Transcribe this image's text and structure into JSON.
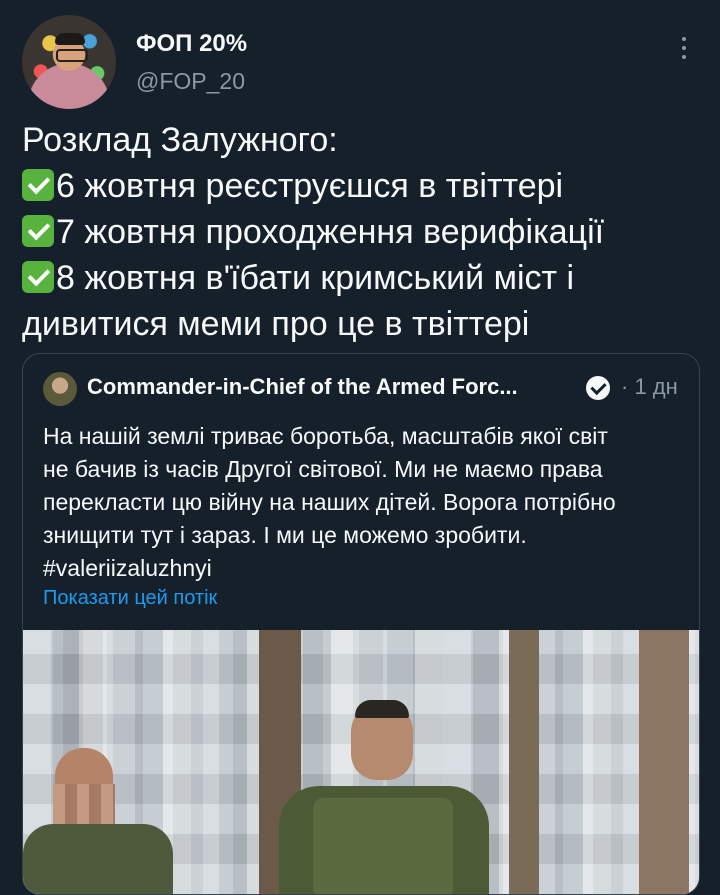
{
  "tweet": {
    "author_name": "ФОП 20%",
    "author_handle": "@FOP_20",
    "lines": [
      {
        "check": false,
        "text": "Розклад Залужного:"
      },
      {
        "check": true,
        "text": "6 жовтня реєструєшся в твіттері"
      },
      {
        "check": true,
        "text": "7 жовтня проходження верифікації"
      },
      {
        "check": true,
        "text": "8 жовтня в'їбати кримський міст і"
      },
      {
        "check": false,
        "text": "дивитися меми про це в твіттері"
      }
    ],
    "check_icon": "check-mark-button-emoji",
    "more_icon": "more-vertical-icon"
  },
  "quoted": {
    "author_name": "Commander-in-Chief of the Armed Forc...",
    "verified_icon": "verified-badge-icon",
    "time": "· 1 дн",
    "lines": [
      "На нашій землі триває боротьба, масштабів якої світ",
      "не бачив із часів Другої світової. Ми не маємо права",
      "перекласти цю війну на наших дітей. Ворога потрібно",
      "знищити тут і зараз. І ми це можемо зробити.",
      "#valeriizaluzhnyi"
    ],
    "show_thread": "Показати цей потік"
  },
  "colors": {
    "background": "#15202b",
    "text": "#f7f9f9",
    "secondary": "#8b98a5",
    "link": "#1d9bf0",
    "border": "#38444d"
  }
}
